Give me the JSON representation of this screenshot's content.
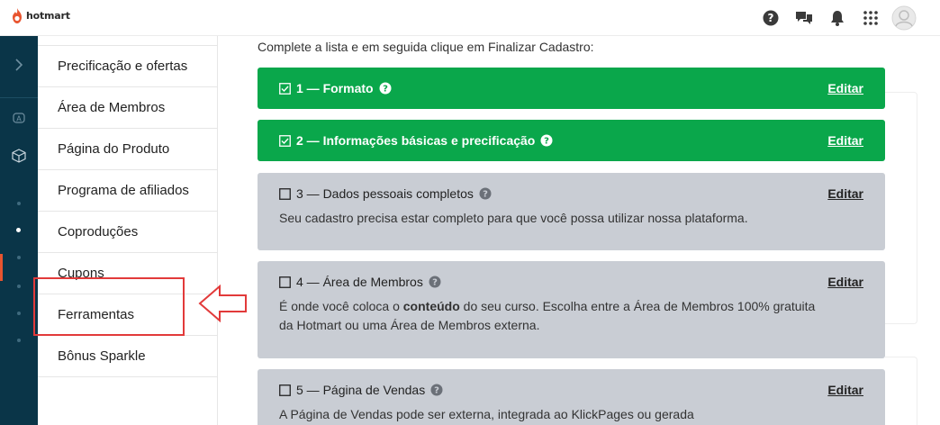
{
  "app": {
    "brand": "hotmart"
  },
  "topbar": {
    "icons": [
      "help-icon",
      "chat-icon",
      "bell-icon",
      "apps-grid-icon",
      "avatar"
    ]
  },
  "rail": {
    "items": [
      "chevron-right-icon",
      "brain-icon",
      "box-icon"
    ],
    "dots": 6,
    "active_dot_index": 1
  },
  "menu": {
    "items": [
      {
        "label": "Precificação e ofertas"
      },
      {
        "label": "Área de Membros"
      },
      {
        "label": "Página do Produto"
      },
      {
        "label": "Programa de afiliados"
      },
      {
        "label": "Coproduções"
      },
      {
        "label": "Cupons"
      },
      {
        "label": "Ferramentas"
      },
      {
        "label": "Bônus Sparkle"
      }
    ],
    "highlighted": "Ferramentas"
  },
  "main": {
    "intro": "Complete a lista e em seguida clique em Finalizar Cadastro:",
    "edit_label": "Editar",
    "steps": [
      {
        "title": "1 — Formato",
        "status": "done"
      },
      {
        "title": "2 — Informações básicas e precificação",
        "status": "done"
      },
      {
        "title": "3 — Dados pessoais completos",
        "status": "todo",
        "desc": "Seu cadastro precisa estar completo para que você possa utilizar nossa plataforma."
      },
      {
        "title": "4 — Área de Membros",
        "status": "todo",
        "desc_pre": "É onde você coloca o ",
        "desc_bold": "conteúdo",
        "desc_post": " do seu curso. Escolha entre a Área de Membros 100% gratuita da Hotmart ou uma Área de Membros externa."
      },
      {
        "title": "5 — Página de Vendas",
        "status": "todo",
        "desc": "A Página de Vendas pode ser externa, integrada ao KlickPages ou gerada"
      }
    ]
  },
  "colors": {
    "brand_orange": "#e8542f",
    "rail": "#0a3548",
    "done_green": "#0aa74b",
    "todo_gray": "#c9cdd4",
    "highlight_red": "#e23a3a"
  }
}
